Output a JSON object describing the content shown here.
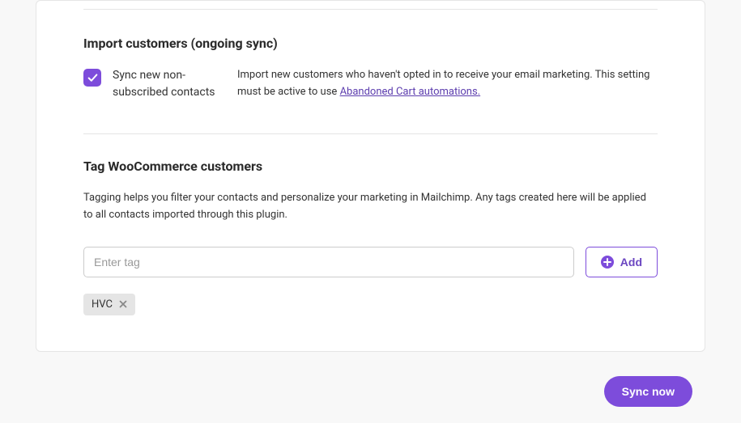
{
  "import": {
    "title": "Import customers (ongoing sync)",
    "checkbox_label": "Sync new non-subscribed contacts",
    "description_pre": "Import new customers who haven't opted in to receive your email marketing. This setting must be active to use ",
    "description_link": "Abandoned Cart automations."
  },
  "tags": {
    "title": "Tag WooCommerce customers",
    "description": "Tagging helps you filter your contacts and personalize your marketing in Mailchimp. Any tags created here will be applied to all contacts imported through this plugin.",
    "input_placeholder": "Enter tag",
    "add_label": "Add",
    "chip_label": "HVC"
  },
  "sync_button": "Sync now"
}
